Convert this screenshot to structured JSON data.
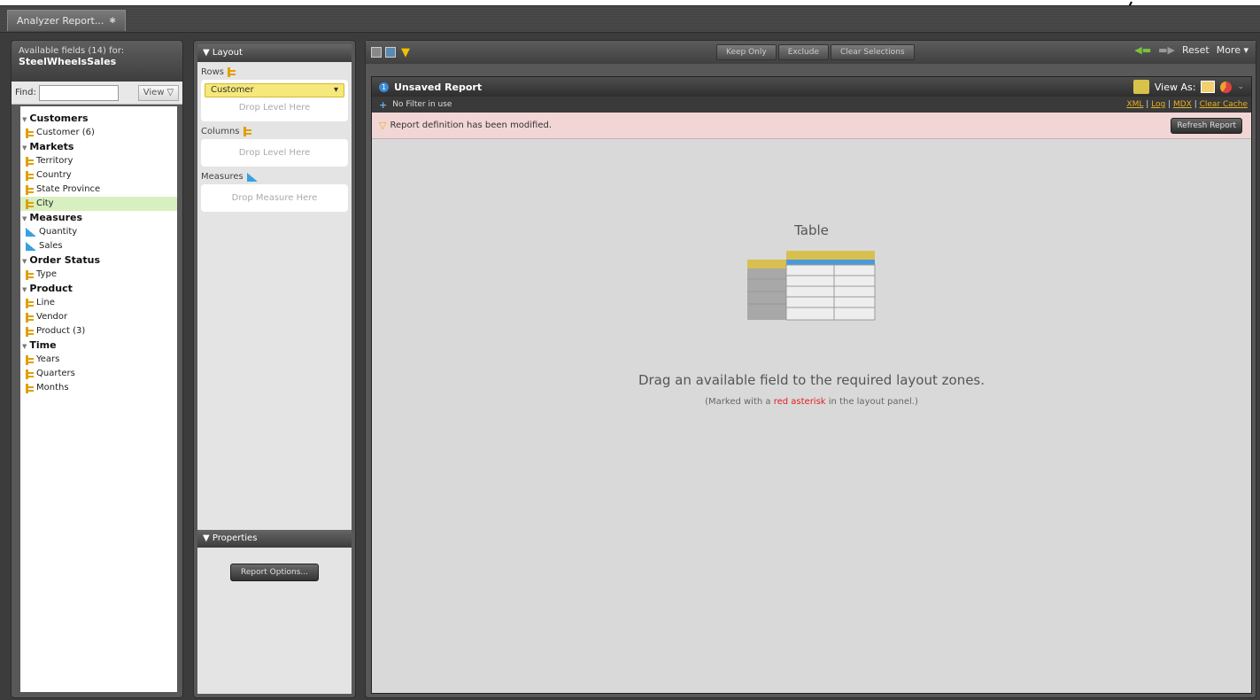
{
  "tab": {
    "label": "Analyzer Report..."
  },
  "fields": {
    "header_line1": "Available fields (14) for:",
    "header_line2": "SteelWheelsSales",
    "find_label": "Find:",
    "view_label": "View",
    "groups": [
      {
        "name": "Customers",
        "items": [
          {
            "label": "Customer (6)",
            "icon": "dimension-icon"
          }
        ]
      },
      {
        "name": "Markets",
        "items": [
          {
            "label": "Territory",
            "icon": "dimension-icon"
          },
          {
            "label": "Country",
            "icon": "dimension-icon"
          },
          {
            "label": "State Province",
            "icon": "dimension-icon"
          },
          {
            "label": "City",
            "icon": "dimension-icon"
          }
        ]
      },
      {
        "name": "Measures",
        "items": [
          {
            "label": "Quantity",
            "icon": "measure-icon"
          },
          {
            "label": "Sales",
            "icon": "measure-icon"
          }
        ]
      },
      {
        "name": "Order Status",
        "items": [
          {
            "label": "Type",
            "icon": "dimension-icon"
          }
        ]
      },
      {
        "name": "Product",
        "items": [
          {
            "label": "Line",
            "icon": "dimension-icon"
          },
          {
            "label": "Vendor",
            "icon": "dimension-icon"
          },
          {
            "label": "Product (3)",
            "icon": "dimension-icon"
          }
        ]
      },
      {
        "name": "Time",
        "items": [
          {
            "label": "Years",
            "icon": "dimension-icon"
          },
          {
            "label": "Quarters",
            "icon": "dimension-icon"
          },
          {
            "label": "Months",
            "icon": "dimension-icon"
          }
        ]
      }
    ],
    "selected_item": "City"
  },
  "layout": {
    "header": "▼ Layout",
    "rows_label": "Rows",
    "rows_chip": "Customer",
    "rows_drop": "Drop Level Here",
    "columns_label": "Columns",
    "columns_drop": "Drop Level Here",
    "measures_label": "Measures",
    "measures_drop": "Drop Measure Here",
    "properties_header": "▼ Properties",
    "report_options": "Report Options..."
  },
  "toolbar": {
    "keep_only": "Keep Only",
    "exclude": "Exclude",
    "clear_selections": "Clear Selections",
    "reset": "Reset",
    "more": "More ▾"
  },
  "report": {
    "number": "1",
    "title": "Unsaved Report",
    "view_as": "View As:",
    "filter_text": "No Filter in use",
    "links": {
      "xml": "XML",
      "log": "Log",
      "mdx": "MDX",
      "clear_cache": "Clear Cache"
    },
    "warning": "Report definition has been modified.",
    "refresh": "Refresh Report",
    "placeholder_title": "Table",
    "placeholder_main": "Drag an available field to the required layout zones.",
    "placeholder_sub_pre": "(Marked with a ",
    "placeholder_sub_red": "red asterisk",
    "placeholder_sub_post": " in the layout panel.)"
  },
  "colors": {
    "accent_yellow": "#e0a000",
    "measure_blue": "#3aa0e0",
    "warning_bg": "#f2d6d6",
    "link": "#e8b020"
  }
}
